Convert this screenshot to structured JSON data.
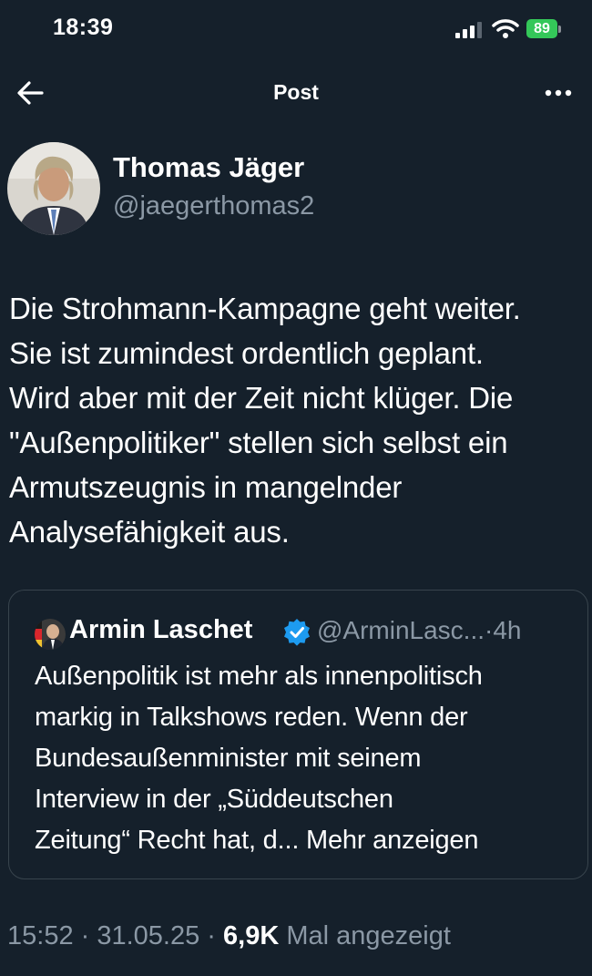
{
  "status_bar": {
    "time": "18:39",
    "battery_level": "89"
  },
  "nav": {
    "title": "Post"
  },
  "author": {
    "name": "Thomas Jäger",
    "handle": "@jaegerthomas2"
  },
  "tweet": {
    "lines": [
      "Die Strohmann-Kampagne geht weiter.",
      "Sie ist zumindest ordentlich geplant.",
      "Wird aber mit der Zeit nicht klüger. Die",
      "\"Außenpolitiker\" stellen sich selbst ein",
      "Armutszeugnis in mangelnder",
      "Analysefähigkeit aus."
    ]
  },
  "quote": {
    "name": "Armin Laschet",
    "handle_time": "@ArminLasc...·4h",
    "lines": [
      "Außenpolitik ist mehr als innenpolitisch",
      "markig in Talkshows reden. Wenn der",
      "Bundesaußenminister mit seinem",
      "Interview in der „Süddeutschen"
    ],
    "last_line": "Zeitung“  Recht hat, d...",
    "show_more": "Mehr anzeigen"
  },
  "meta": {
    "time": "15:52",
    "sep1": " · ",
    "date": "31.05.25",
    "sep2": " · ",
    "views": "6,9K",
    "views_label": " Mal angezeigt"
  },
  "colors": {
    "background": "#15202b",
    "secondary_text": "#8b98a5",
    "border": "#38444d",
    "verified": "#1d9bf0",
    "battery": "#34c759"
  },
  "icons": [
    "back-arrow-icon",
    "more-icon",
    "signal-icon",
    "wifi-icon",
    "battery-icon",
    "verified-badge-icon"
  ]
}
